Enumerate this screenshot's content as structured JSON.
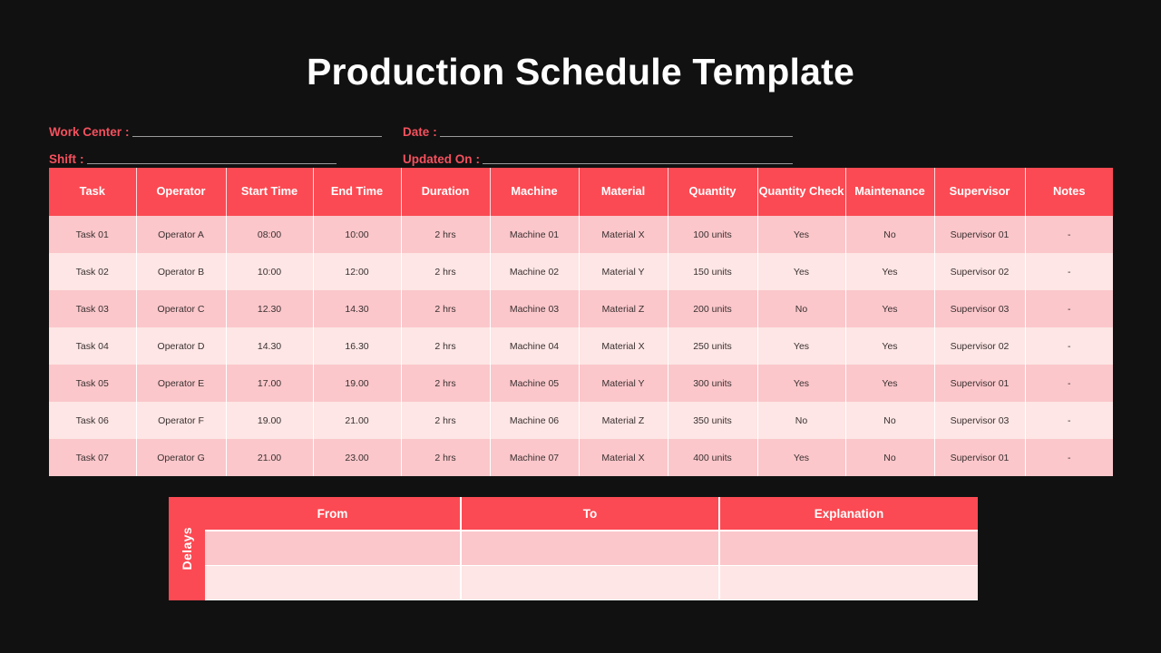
{
  "slide": {
    "title": "Production Schedule Template",
    "background_color": "#111111",
    "accent_color": "#FB4A53",
    "row_color_odd": "#FBC7CB",
    "row_color_even": "#FDE6E5",
    "label_color": "#F4515E"
  },
  "form": {
    "fields": [
      {
        "label": "Work Center",
        "colon": ":",
        "value": ""
      },
      {
        "label": "Date",
        "colon": ":",
        "value": ""
      },
      {
        "label": "Shift",
        "colon": ":",
        "value": ""
      },
      {
        "label": "Updated On",
        "colon": ":",
        "value": ""
      }
    ]
  },
  "schedule_table": {
    "headers": [
      "Task",
      "Operator",
      "Start Time",
      "End Time",
      "Duration",
      "Machine",
      "Material",
      "Quantity",
      "Quantity Check",
      "Maintenance",
      "Supervisor",
      "Notes"
    ],
    "rows": [
      [
        "Task 01",
        "Operator A",
        "08:00",
        "10:00",
        "2 hrs",
        "Machine 01",
        "Material X",
        "100 units",
        "Yes",
        "No",
        "Supervisor 01",
        "-"
      ],
      [
        "Task 02",
        "Operator B",
        "10:00",
        "12:00",
        "2 hrs",
        "Machine 02",
        "Material Y",
        "150 units",
        "Yes",
        "Yes",
        "Supervisor 02",
        "-"
      ],
      [
        "Task 03",
        "Operator C",
        "12.30",
        "14.30",
        "2 hrs",
        "Machine 03",
        "Material Z",
        "200 units",
        "No",
        "Yes",
        "Supervisor 03",
        "-"
      ],
      [
        "Task 04",
        "Operator D",
        "14.30",
        "16.30",
        "2 hrs",
        "Machine 04",
        "Material X",
        "250 units",
        "Yes",
        "Yes",
        "Supervisor 02",
        "-"
      ],
      [
        "Task 05",
        "Operator E",
        "17.00",
        "19.00",
        "2 hrs",
        "Machine 05",
        "Material Y",
        "300 units",
        "Yes",
        "Yes",
        "Supervisor 01",
        "-"
      ],
      [
        "Task 06",
        "Operator F",
        "19.00",
        "21.00",
        "2 hrs",
        "Machine 06",
        "Material Z",
        "350 units",
        "No",
        "No",
        "Supervisor 03",
        "-"
      ],
      [
        "Task 07",
        "Operator G",
        "21.00",
        "23.00",
        "2 hrs",
        "Machine 07",
        "Material X",
        "400 units",
        "Yes",
        "No",
        "Supervisor 01",
        "-"
      ]
    ]
  },
  "delays_table": {
    "side_label": "Delays",
    "headers": [
      "From",
      "To",
      "Explanation"
    ],
    "rows": [
      [
        "",
        "",
        ""
      ],
      [
        "",
        "",
        ""
      ]
    ]
  }
}
